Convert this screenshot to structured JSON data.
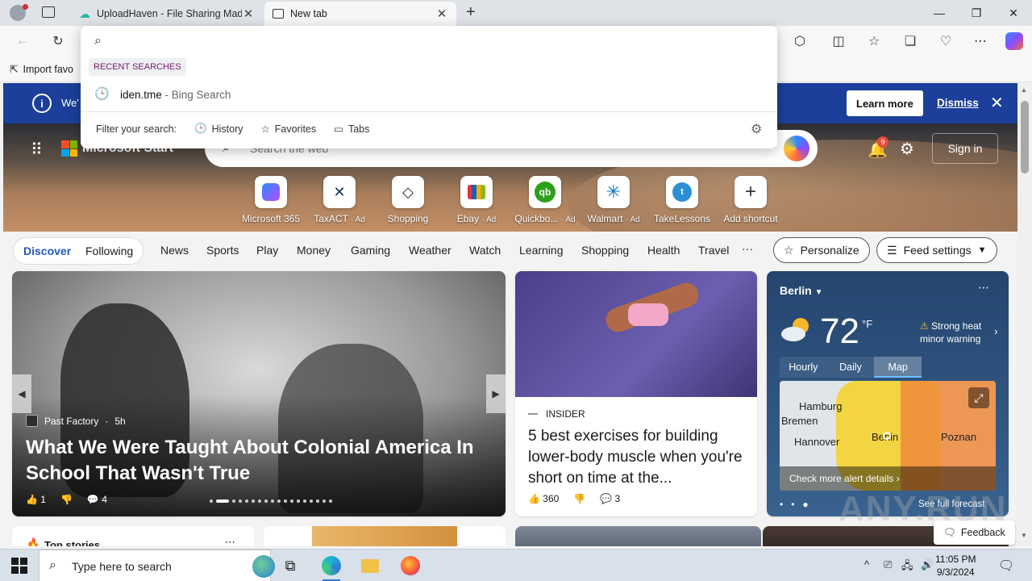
{
  "browser": {
    "tabs": [
      {
        "title": "UploadHaven - File Sharing Made Simple",
        "active": false
      },
      {
        "title": "New tab",
        "active": true
      }
    ],
    "favorites_bar": {
      "import_label": "Import favo"
    }
  },
  "omnibox": {
    "recent_label": "RECENT SEARCHES",
    "history_item": {
      "query": "iden.tme",
      "engine": " - Bing Search"
    },
    "filter_label": "Filter your search:",
    "filters": [
      "History",
      "Favorites",
      "Tabs"
    ]
  },
  "banner": {
    "text": "We'",
    "learn_more": "Learn more",
    "dismiss": "Dismiss"
  },
  "header": {
    "brand": "Microsoft Start",
    "search_placeholder": "Search the web",
    "notification_count": "9",
    "sign_in": "Sign in"
  },
  "shortcuts": [
    {
      "label": "Microsoft 365",
      "ad": "",
      "icon": "m365-icon"
    },
    {
      "label": "TaxACT",
      "ad": "· Ad",
      "icon": "taxact-icon"
    },
    {
      "label": "Shopping",
      "ad": "",
      "icon": "tag-icon"
    },
    {
      "label": "Ebay",
      "ad": "· Ad",
      "icon": "ebay-icon"
    },
    {
      "label": "Quickbo...",
      "ad": "· Ad",
      "icon": "quickbooks-icon"
    },
    {
      "label": "Walmart",
      "ad": "· Ad",
      "icon": "walmart-icon"
    },
    {
      "label": "TakeLessons",
      "ad": "",
      "icon": "takelessons-icon"
    },
    {
      "label": "Add shortcut",
      "ad": "",
      "icon": "plus-icon"
    }
  ],
  "feed_nav": {
    "discover": "Discover",
    "following": "Following",
    "links": [
      "News",
      "Sports",
      "Play",
      "Money",
      "Gaming",
      "Weather",
      "Watch",
      "Learning",
      "Shopping",
      "Health",
      "Travel"
    ],
    "more": "···",
    "personalize": "Personalize",
    "feed_settings": "Feed settings"
  },
  "main_story": {
    "source": "Past Factory",
    "age": "5h",
    "headline": "What We Were Taught About Colonial America In School That Wasn't True",
    "likes": "1",
    "comments": "4"
  },
  "news_card": {
    "source": "INSIDER",
    "headline": "5 best exercises for building lower-body muscle when you're short on time at the...",
    "likes": "360",
    "comments": "3"
  },
  "weather": {
    "city": "Berlin",
    "temperature": "72",
    "unit": "°F",
    "alert": "Strong heat minor warning",
    "tabs": [
      "Hourly",
      "Daily",
      "Map"
    ],
    "selected_tab": "Map",
    "map_labels": [
      "Hamburg",
      "Bremen",
      "Hannover",
      "Berlin",
      "Poznan"
    ],
    "alert_details": "Check more alert details",
    "full_forecast": "See full forecast"
  },
  "row2": {
    "top_stories": "Top stories"
  },
  "feedback": "Feedback",
  "taskbar": {
    "search_placeholder": "Type here to search",
    "time": "11:05 PM",
    "date": "9/3/2024"
  },
  "watermark": "ANY.RUN"
}
